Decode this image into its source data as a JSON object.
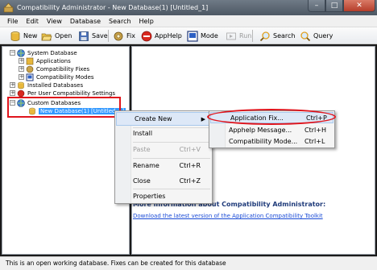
{
  "window": {
    "title": "Compatibility Administrator - New Database(1) [Untitled_1]",
    "buttons": {
      "minimize": "–",
      "maximize": "□",
      "close": "✕"
    }
  },
  "menubar": [
    "File",
    "Edit",
    "View",
    "Database",
    "Search",
    "Help"
  ],
  "toolbar": {
    "new": "New",
    "open": "Open",
    "save": "Save",
    "fix": "Fix",
    "apphelp": "AppHelp",
    "mode": "Mode",
    "run": "Run",
    "search": "Search",
    "query": "Query"
  },
  "tree": {
    "system_database": "System Database",
    "applications": "Applications",
    "compatibility_fixes": "Compatibility Fixes",
    "compatibility_modes": "Compatibility Modes",
    "installed_databases": "Installed Databases",
    "per_user_settings": "Per User Compatibility Settings",
    "custom_databases": "Custom Databases",
    "new_database": "New Database(1) [Untitled_1]"
  },
  "context_menu": {
    "create_new": "Create New",
    "install": "Install",
    "paste": {
      "label": "Paste",
      "shortcut": "Ctrl+V"
    },
    "rename": {
      "label": "Rename",
      "shortcut": "Ctrl+R"
    },
    "close": {
      "label": "Close",
      "shortcut": "Ctrl+Z"
    },
    "properties": "Properties"
  },
  "submenu": {
    "application_fix": {
      "label": "Application Fix...",
      "shortcut": "Ctrl+P"
    },
    "apphelp_message": {
      "label": "Apphelp Message...",
      "shortcut": "Ctrl+H"
    },
    "compatibility_mode": {
      "label": "Compatibility Mode...",
      "shortcut": "Ctrl+L"
    }
  },
  "content": {
    "info_heading": "More information about Compatibility Administrator:",
    "download_link": "Download the latest version of the Application Compatibility Toolkit"
  },
  "statusbar": "This is an open working database. Fixes can be created for this database",
  "colors": {
    "highlight": "#e0141c",
    "selection": "#3399ff",
    "link": "#1a4bd6"
  }
}
